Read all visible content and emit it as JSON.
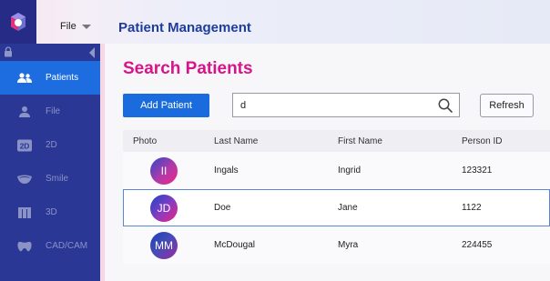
{
  "header": {
    "file_menu": "File",
    "app_title": "Patient Management"
  },
  "sidebar": {
    "items": [
      {
        "label": "Patients",
        "icon": "people-icon",
        "active": true
      },
      {
        "label": "File",
        "icon": "person-icon",
        "active": false
      },
      {
        "label": "2D",
        "icon": "2d-icon",
        "active": false
      },
      {
        "label": "Smile",
        "icon": "smile-icon",
        "active": false
      },
      {
        "label": "3D",
        "icon": "3d-icon",
        "active": false
      },
      {
        "label": "CAD/CAM",
        "icon": "cadcam-icon",
        "active": false
      }
    ],
    "icon_2d_text": "2D"
  },
  "main": {
    "title": "Search Patients",
    "add_button": "Add Patient",
    "search_value": "d",
    "refresh_button": "Refresh",
    "columns": [
      "Photo",
      "Last Name",
      "First Name",
      "Person ID"
    ],
    "rows": [
      {
        "initials": "II",
        "last_name": "Ingals",
        "first_name": "Ingrid",
        "person_id": "123321",
        "selected": false
      },
      {
        "initials": "JD",
        "last_name": "Doe",
        "first_name": "Jane",
        "person_id": "1122",
        "selected": true
      },
      {
        "initials": "MM",
        "last_name": "McDougal",
        "first_name": "Myra",
        "person_id": "224455",
        "selected": false
      }
    ]
  },
  "colors": {
    "sidebar": "#2a3794",
    "active_nav": "#1d6de0",
    "title_pink": "#d8148a",
    "app_title_blue": "#1d3d9d",
    "primary_button": "#1a6bdd"
  }
}
